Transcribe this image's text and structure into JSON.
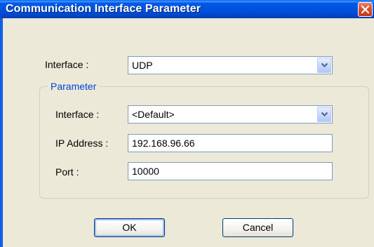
{
  "window": {
    "title": "Communication Interface Parameter"
  },
  "interface": {
    "label": "Interface :",
    "value": "UDP"
  },
  "parameter": {
    "group_title": "Parameter",
    "interface_label": "Interface :",
    "interface_value": "<Default>",
    "ip_label": "IP Address :",
    "ip_value": "192.168.96.66",
    "port_label": "Port :",
    "port_value": "10000"
  },
  "buttons": {
    "ok": "OK",
    "cancel": "Cancel"
  }
}
